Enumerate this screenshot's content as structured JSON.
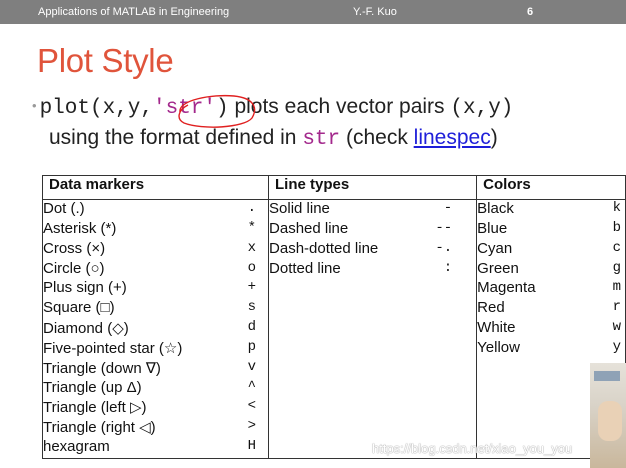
{
  "header": {
    "course": "Applications of MATLAB in Engineering",
    "author": "Y.-F. Kuo",
    "page_number": "6"
  },
  "slide": {
    "title": "Plot Style",
    "bullet": {
      "code_plot": "plot(x,y,",
      "code_str": "'str'",
      "code_close": ")",
      "text_plots": " plots each vector pairs ",
      "code_xy": "(x,y)",
      "text_using": "using the format defined in ",
      "code_str_var": "str",
      "text_check": " (check ",
      "link": "linespec",
      "text_close": ")"
    }
  },
  "table": {
    "headers": [
      "Data markers",
      "Line types",
      "Colors"
    ],
    "markers": [
      {
        "label": "Dot (.)",
        "symbol": "."
      },
      {
        "label": "Asterisk (*)",
        "symbol": "*"
      },
      {
        "label": "Cross (×)",
        "symbol": "x"
      },
      {
        "label": "Circle (○)",
        "symbol": "o"
      },
      {
        "label": "Plus sign (+)",
        "symbol": "+"
      },
      {
        "label": "Square (□)",
        "symbol": "s"
      },
      {
        "label": "Diamond (◇)",
        "symbol": "d"
      },
      {
        "label": "Five-pointed star (☆)",
        "symbol": "p"
      },
      {
        "label": "Triangle (down ∇)",
        "symbol": "v"
      },
      {
        "label": "Triangle (up Δ)",
        "symbol": "^"
      },
      {
        "label": "Triangle (left ▷)",
        "symbol": "<"
      },
      {
        "label": "Triangle (right ◁)",
        "symbol": ">"
      },
      {
        "label": "hexagram",
        "symbol": "H"
      }
    ],
    "line_types": [
      {
        "label": "Solid line",
        "symbol": "-"
      },
      {
        "label": "Dashed line",
        "symbol": "--"
      },
      {
        "label": "Dash-dotted line",
        "symbol": "-."
      },
      {
        "label": "Dotted line",
        "symbol": ":"
      }
    ],
    "colors": [
      {
        "label": "Black",
        "symbol": "k"
      },
      {
        "label": "Blue",
        "symbol": "b"
      },
      {
        "label": "Cyan",
        "symbol": "c"
      },
      {
        "label": "Green",
        "symbol": "g"
      },
      {
        "label": "Magenta",
        "symbol": "m"
      },
      {
        "label": "Red",
        "symbol": "r"
      },
      {
        "label": "White",
        "symbol": "w"
      },
      {
        "label": "Yellow",
        "symbol": "y"
      }
    ]
  },
  "watermark": "https://blog.csdn.net/xiao_you_you",
  "theme": {
    "title_color": "#e0543b",
    "header_bg": "#7f7f7f",
    "link_color": "#1f1fd9",
    "code_color": "#a3288c",
    "annotation_color": "#e02020"
  }
}
